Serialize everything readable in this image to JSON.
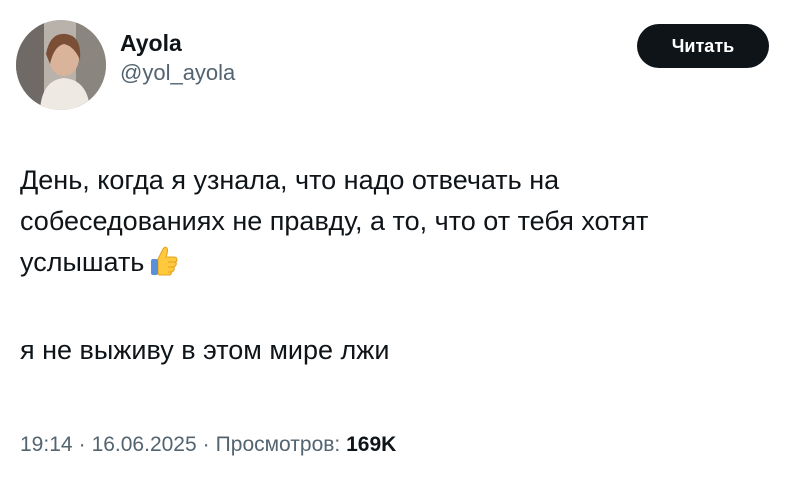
{
  "author": {
    "display_name": "Ayola",
    "handle": "@yol_ayola",
    "follow_label": "Читать"
  },
  "tweet": {
    "text_part1": "День, когда я узнала, что надо отвечать на собеседованиях не правду, а то, что от тебя хотят услышать",
    "emoji": "thumbs-up-icon",
    "text_part2": "я не выживу в этом мире лжи"
  },
  "meta": {
    "time": "19:14",
    "separator": "·",
    "date": "16.06.2025",
    "views_label": "Просмотров:",
    "views_count": "169K"
  },
  "colors": {
    "text": "#0f1419",
    "secondary": "#536471",
    "button_bg": "#0f1419",
    "button_text": "#ffffff"
  }
}
